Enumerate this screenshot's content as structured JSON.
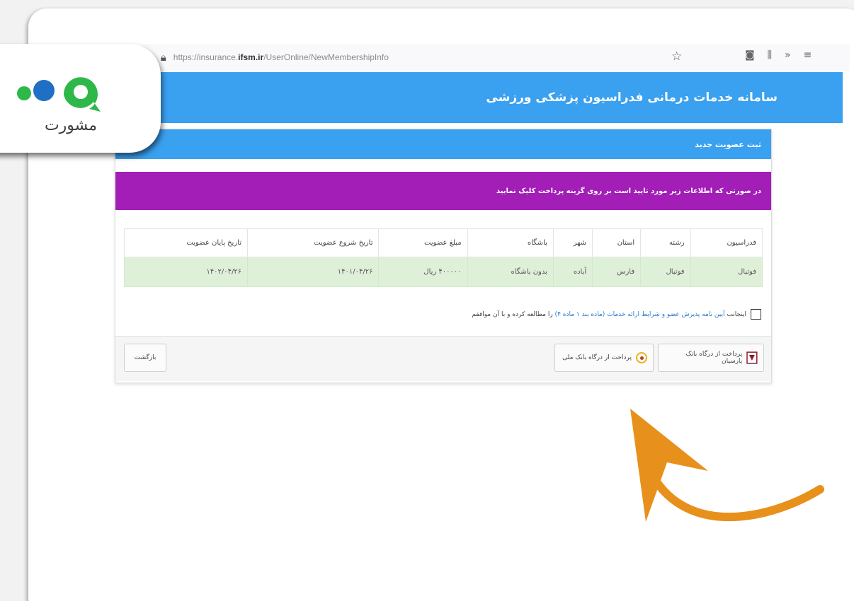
{
  "browser": {
    "url_prefix": "https://insurance.",
    "url_domain": "ifsm.ir",
    "url_path": "/UserOnline/NewMembershipInfo"
  },
  "site": {
    "title": "سامانه خدمات درمانی فدراسیون پزشکی ورزشی"
  },
  "panel": {
    "heading": "ثبت عضویت جدید",
    "alert": "در صورتی که اطلاعات زیر مورد تایید است بر روی گزینه پرداخت کلیک نمایید"
  },
  "table": {
    "headers": [
      "فدراسیون",
      "رشته",
      "استان",
      "شهر",
      "باشگاه",
      "مبلغ عضویت",
      "تاریخ شروع عضویت",
      "تاریخ پایان عضویت"
    ],
    "rows": [
      [
        "فوتبال",
        "فوتبال",
        "فارس",
        "آباده",
        "بدون باشگاه",
        "۴۰۰۰۰۰ ریال",
        "۱۴۰۱/۰۴/۲۶",
        "۱۴۰۲/۰۴/۲۶"
      ]
    ]
  },
  "agreement": {
    "prefix": "اینجانب",
    "link": "آیین نامه پذیرش عضو و شرایط ارائه خدمات (ماده بند ۱ ماده ۴)",
    "suffix": "را مطالعه کرده و با آن موافقم"
  },
  "actions": {
    "pay_parsian": "پرداخت از درگاه بانک پارسیان",
    "pay_melli": "پرداخت از درگاه بانک ملی",
    "back": "بازگشت"
  },
  "logo": {
    "text": "مشورت"
  },
  "colors": {
    "header_blue": "#3aa0f0",
    "alert_purple": "#a21eb7",
    "row_green": "#dff0d8",
    "logo_blue": "#1f6fc4",
    "logo_green": "#2fb84a",
    "arrow_orange": "#e8901c"
  }
}
